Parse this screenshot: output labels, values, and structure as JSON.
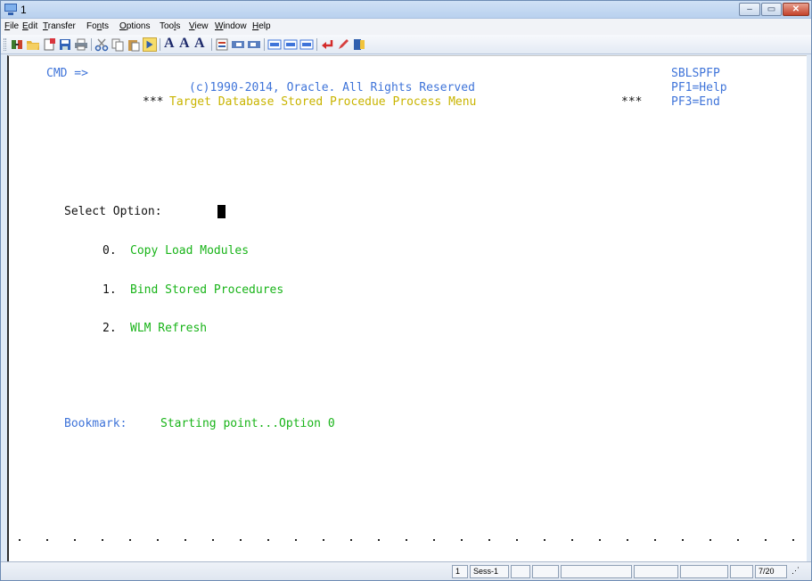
{
  "window": {
    "title": "1",
    "controls": {
      "minimize": "–",
      "maximize": "▭",
      "close": "✕"
    }
  },
  "menu": [
    {
      "pre": "",
      "acc": "F",
      "post": "ile"
    },
    {
      "pre": "",
      "acc": "E",
      "post": "dit"
    },
    {
      "pre": "",
      "acc": "T",
      "post": "ransfer"
    },
    {
      "pre": "Fo",
      "acc": "n",
      "post": "ts"
    },
    {
      "pre": "",
      "acc": "O",
      "post": "ptions"
    },
    {
      "pre": "Too",
      "acc": "l",
      "post": "s"
    },
    {
      "pre": "",
      "acc": "V",
      "post": "iew"
    },
    {
      "pre": "",
      "acc": "W",
      "post": "indow"
    },
    {
      "pre": "",
      "acc": "H",
      "post": "elp"
    }
  ],
  "toolbar": {
    "font_buttons": [
      "A",
      "A",
      "A"
    ]
  },
  "terminal": {
    "cmd_prompt": "CMD =>",
    "program_id": "SBLSPFP",
    "copyright": "(c)1990-2014, Oracle. All Rights Reserved",
    "pf1": "PF1=Help",
    "pf3": "PF3=End",
    "title_stars_left": "***",
    "title": "Target Database Stored Procedue Process Menu",
    "title_stars_right": "***",
    "select_label": "Select Option:",
    "options": [
      {
        "num": "0.",
        "label": "Copy Load Modules"
      },
      {
        "num": "1.",
        "label": "Bind Stored Procedures"
      },
      {
        "num": "2.",
        "label": "WLM Refresh"
      }
    ],
    "bookmark_label": "Bookmark:",
    "bookmark_value": "Starting point...Option 0"
  },
  "status": {
    "session_number": "1",
    "session_name": "Sess-1",
    "cursor_position": "7/20"
  },
  "colors": {
    "terminal_blue": "#3f74d9",
    "terminal_yellow": "#c9b400",
    "terminal_green": "#19b419"
  }
}
